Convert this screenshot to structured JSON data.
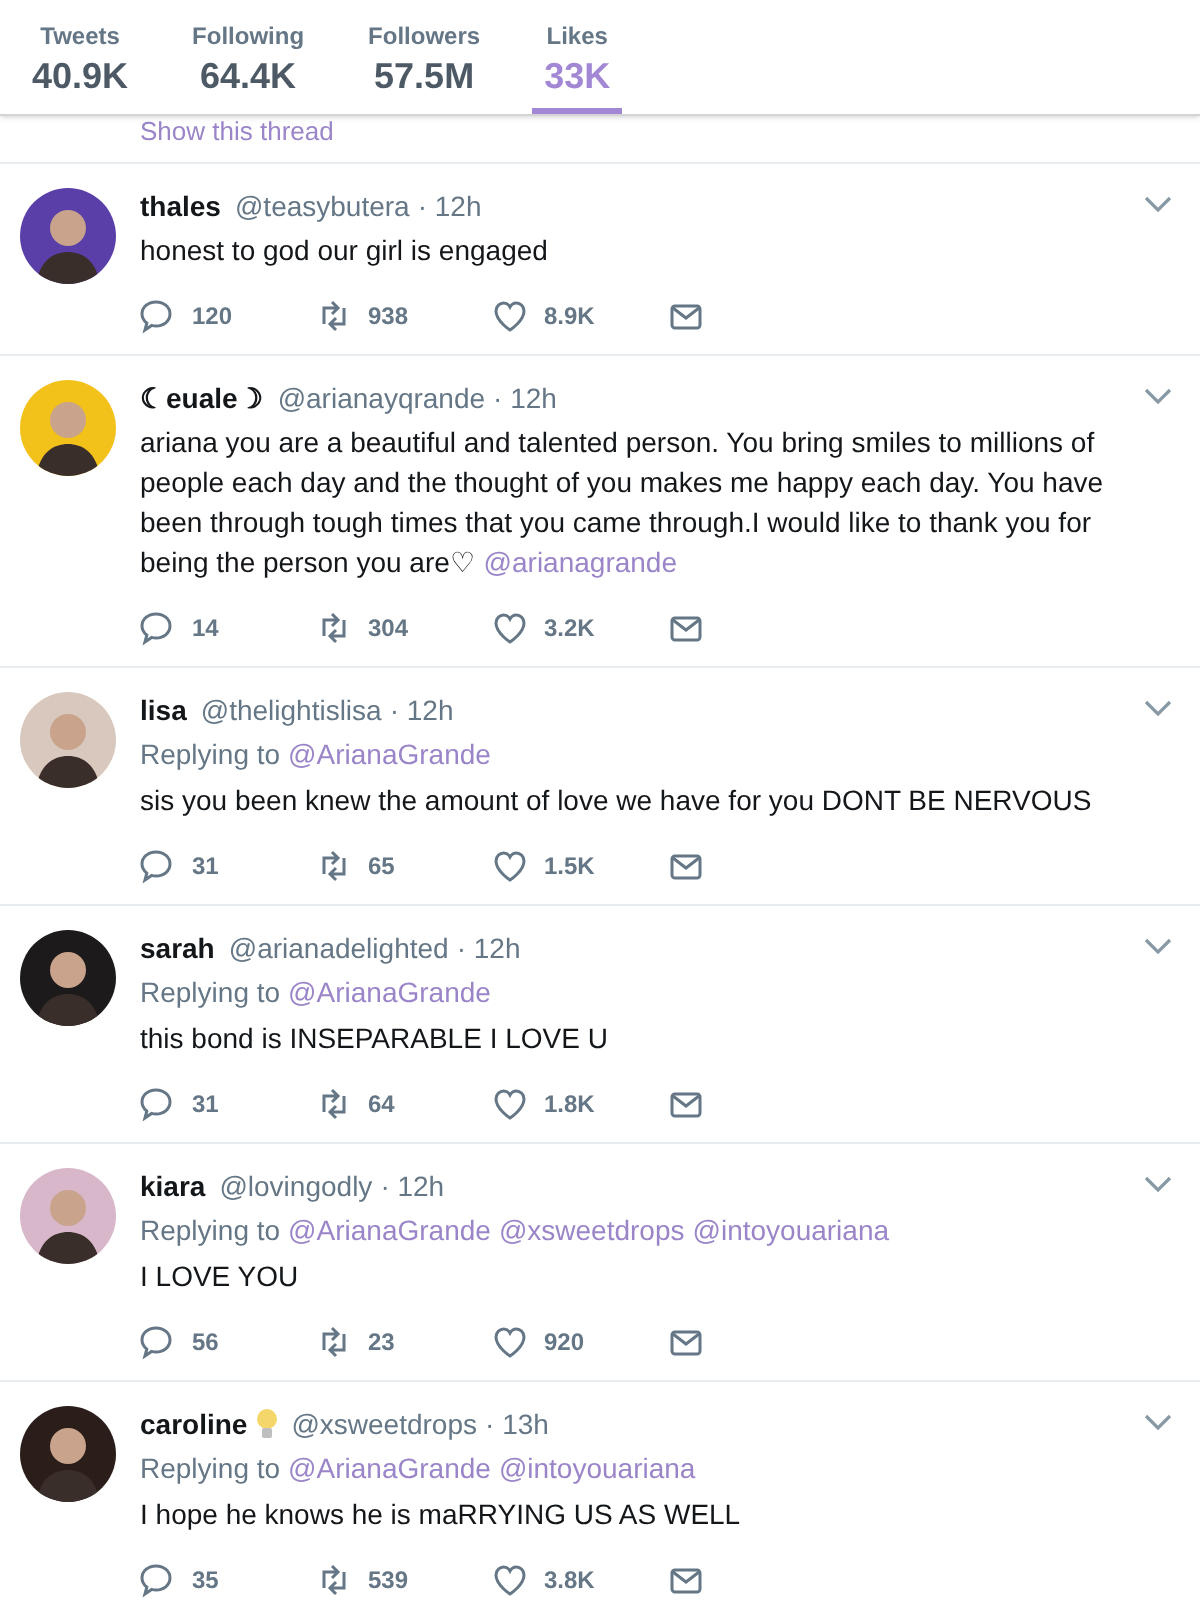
{
  "profile_nav": [
    {
      "label": "Tweets",
      "value": "40.9K",
      "selected": false
    },
    {
      "label": "Following",
      "value": "64.4K",
      "selected": false
    },
    {
      "label": "Followers",
      "value": "57.5M",
      "selected": false
    },
    {
      "label": "Likes",
      "value": "33K",
      "selected": true
    }
  ],
  "thread_link": "Show this thread",
  "tweets": [
    {
      "name": "thales",
      "name_badge": false,
      "handle": "@teasybutera",
      "time": "· 12h",
      "text": "honest to god our girl is engaged",
      "replies": "120",
      "retweets": "938",
      "likes": "8.9K"
    },
    {
      "name": "☾euale☽",
      "name_badge": false,
      "handle": "@arianayqrande",
      "time": "· 12h",
      "text": "ariana you are a beautiful and talented person. You bring smiles to millions of people each day and the thought of you makes me happy each day. You have been through tough times that you came through.I would like to thank you for being the person you are♡",
      "mention": "@arianagrande",
      "replies": "14",
      "retweets": "304",
      "likes": "3.2K"
    },
    {
      "name": "lisa",
      "name_badge": false,
      "handle": "@thelightislisa",
      "time": "· 12h",
      "replying_label": "Replying to",
      "replying_to": [
        "@ArianaGrande"
      ],
      "text": "sis you been knew the amount of love we have for you DONT BE NERVOUS",
      "replies": "31",
      "retweets": "65",
      "likes": "1.5K"
    },
    {
      "name": "sarah",
      "name_badge": false,
      "handle": "@arianadelighted",
      "time": "· 12h",
      "replying_label": "Replying to",
      "replying_to": [
        "@ArianaGrande"
      ],
      "text": "this bond is INSEPARABLE I LOVE U",
      "replies": "31",
      "retweets": "64",
      "likes": "1.8K"
    },
    {
      "name": "kiara",
      "name_badge": false,
      "handle": "@lovingodly",
      "time": "· 12h",
      "replying_label": "Replying to",
      "replying_to": [
        "@ArianaGrande",
        "@xsweetdrops",
        "@intoyouariana"
      ],
      "text": "I LOVE YOU",
      "replies": "56",
      "retweets": "23",
      "likes": "920"
    },
    {
      "name": "caroline",
      "name_badge": true,
      "handle": "@xsweetdrops",
      "time": "· 13h",
      "replying_label": "Replying to",
      "replying_to": [
        "@ArianaGrande",
        "@intoyouariana"
      ],
      "text": "I hope he knows he is maRRYING US AS WELL",
      "replies": "35",
      "retweets": "539",
      "likes": "3.8K"
    }
  ]
}
